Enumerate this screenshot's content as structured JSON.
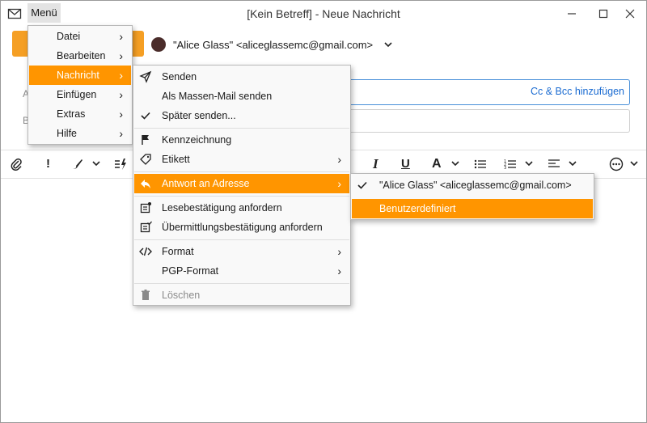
{
  "window": {
    "title": "[Kein Betreff] - Neue Nachricht",
    "menu_button": "Menü"
  },
  "sender": {
    "text": "\"Alice Glass\" <aliceglassemc@gmail.com>"
  },
  "fields": {
    "to_label": "A",
    "subject_label": "B",
    "cc_bcc": "Cc & Bcc hinzufügen"
  },
  "main_menu": {
    "items": [
      "Datei",
      "Bearbeiten",
      "Nachricht",
      "Einfügen",
      "Extras",
      "Hilfe"
    ]
  },
  "message_menu": {
    "senden": "Senden",
    "massen": "Als Massen-Mail senden",
    "spaeter": "Später senden...",
    "kennzeichnung": "Kennzeichnung",
    "etikett": "Etikett",
    "antwort": "Antwort an Adresse",
    "lese": "Lesebestätigung anfordern",
    "uebermittlung": "Übermittlungsbestätigung anfordern",
    "format": "Format",
    "pgp": "PGP-Format",
    "loeschen": "Löschen"
  },
  "reply_menu": {
    "address": "\"Alice Glass\" <aliceglassemc@gmail.com>",
    "custom": "Benutzerdefiniert"
  },
  "toolbar": {
    "important": "!",
    "italic": "I",
    "underline": "U",
    "font": "A"
  },
  "colors": {
    "accent": "#ff9500",
    "send_button": "#f59f24",
    "link": "#1a6bd1"
  }
}
